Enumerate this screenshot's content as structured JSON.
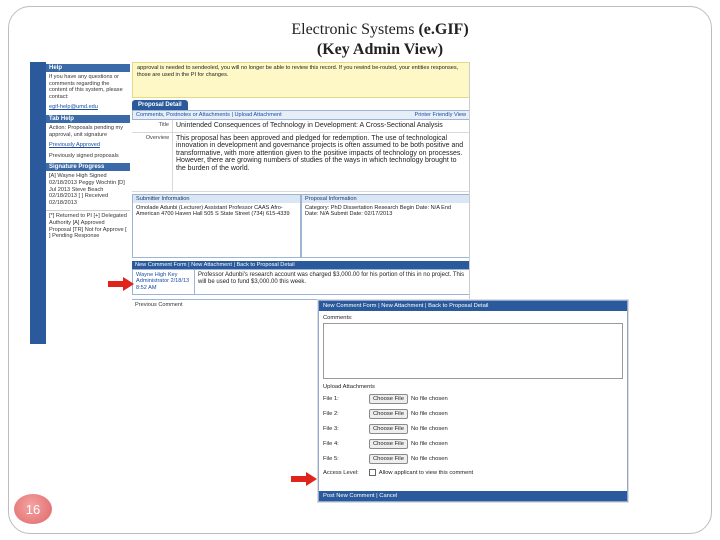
{
  "slide": {
    "title_line1_plain": "Electronic Systems ",
    "title_line1_bold": "(e.GIF)",
    "title_line2": "(Key Admin View)",
    "page_number": "16"
  },
  "sidebar": {
    "help_header": "Help",
    "help_text": "If you have any questions or comments regarding the content of this system, please contact:",
    "help_email": "egif-help@umd.edu",
    "tab_help_header": "Tab Help",
    "tab_help_text": "Action: Proposals pending my approval, unit signature",
    "tab_help_link": "Previously Approved",
    "tab_help_text2": "Previously signed proposals",
    "signature_header": "Signature Progress",
    "signature_text": "[A] Wayne High Signed 02/18/2013 Peggy Wochtin [D] Jul 2013 Steve Beach 02/18/2013 [ ] Received 02/18/2013",
    "legend": "[*] Returned to PI [+] Delegated Authority [A] Approved Proposal [TR] Not for Approve [ ] Pending Response"
  },
  "main": {
    "notice": "approval is needed to sendeoled, you will no longer be able to review this record. If you rewind be-routed, your entities responses, those are used in the PI for changes.",
    "tab_label": "Proposal Detail",
    "subnav_left": "Comments, Postnotes or Attachments | Upload Attachment",
    "subnav_right": "Printer Friendly View",
    "title_label": "Title",
    "title_value": "Unintended Consequences of Technology in Development: A Cross-Sectional Analysis",
    "overview_label": "Overview",
    "overview_value": "This proposal has been approved and pledged for redemption. The use of technological innovation in development and governance projects is often assumed to be both positive and transformative, with more attention given to the positive impacts of technology on processes. However, there are growing numbers of studies of the ways in which technology brought to the burden of the world.",
    "submitter_header": "Submitter Information",
    "submitter_text": "Omolade Adunbi (Lecturer) Assistant Professor CAAS Afro-American 4700 Haven Hall 505 S State Street (734) 615-4339",
    "proposal_header": "Proposal Information",
    "proposal_text": "Category: PhD Dissertation Research Begin Date: N/A End Date: N/A Submit Date: 02/17/2013",
    "comment_bar": "New Comment Form | New Attachment | Back to Proposal Detail",
    "comment_author": "Wayne High Key Administrator 2/18/13 8:52 AM",
    "comment_text": "Professor Adunbi's research account was charged $3,000.00 for his portion of this in no project. This will be used to fund $3,000.00 this week.",
    "prior_comment_label": "Previous Comment"
  },
  "form": {
    "navbar": "New Comment Form | New Attachment | Back to Proposal Detail",
    "comments_label": "Comments:",
    "upload_label": "Upload Attachments",
    "files": [
      {
        "label": "File 1:",
        "button": "Choose File",
        "status": "No file chosen"
      },
      {
        "label": "File 2:",
        "button": "Choose File",
        "status": "No file chosen"
      },
      {
        "label": "File 3:",
        "button": "Choose File",
        "status": "No file chosen"
      },
      {
        "label": "File 4:",
        "button": "Choose File",
        "status": "No file chosen"
      },
      {
        "label": "File 5:",
        "button": "Choose File",
        "status": "No file chosen"
      }
    ],
    "access_label": "Access Level:",
    "access_checkbox": "Allow applicant to view this comment",
    "footer": "Post New Comment | Cancel"
  },
  "colors": {
    "accent_blue": "#2a5a9c",
    "arrow_red": "#e0241b",
    "notice_yellow": "#fdf8c6"
  }
}
